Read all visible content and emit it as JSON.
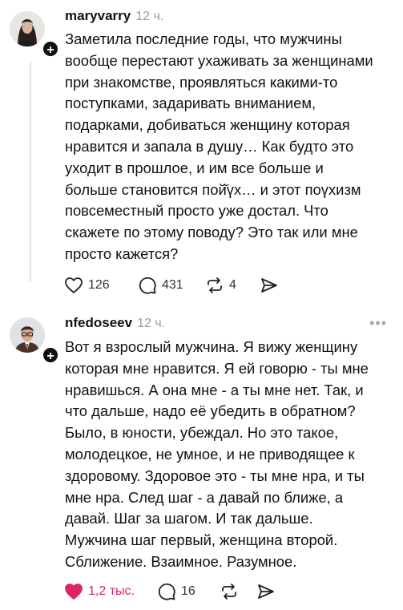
{
  "posts": [
    {
      "username": "maryvarry",
      "time": "12 ч.",
      "lines": [
        "Заметила последние годы, что мужчины",
        "вообще перестают ухаживать за женщинами",
        "при знакомстве, проявляться какими-то",
        "поступками, задаривать вниманием,",
        "подарками, добиваться женщину которая",
        "нравится и запала в душу… Как будто это",
        "уходит в прошлое, и им все больше и",
        "больше становится пой̆үх… и этот поүхизм",
        "повсеместный просто уже достал. Что",
        "скажете по этому поводу? Это так или мне",
        "просто кажется?"
      ],
      "likes": "126",
      "comments": "431",
      "reposts": "4"
    },
    {
      "username": "nfedoseev",
      "time": "12 ч.",
      "more": "•••",
      "lines": [
        "Вот я взрослый мужчина. Я вижу женщину",
        "которая мне нравится. Я ей говорю - ты мне",
        "нравишься. А она мне - а ты мне нет. Так, и",
        "что дальше, надо её убедить в обратном?",
        "Было, в юности, убеждал. Но это такое,",
        "молодецкое, не умное, и не приводящее к",
        "здоровому. Здоровое это - ты мне нра, и ты",
        "мне нра. След шаг - а давай по ближе, а",
        "давай. Шаг за шагом. И так дальше.",
        "Мужчина шаг первый, женщина второй.",
        "Сближение. Взаимное. Разумное."
      ],
      "likes": "1,2 тыс.",
      "comments": "16"
    }
  ],
  "plus_label": "+",
  "colors": {
    "liked": "#e0245e",
    "meta": "#999999",
    "text": "#111111"
  }
}
